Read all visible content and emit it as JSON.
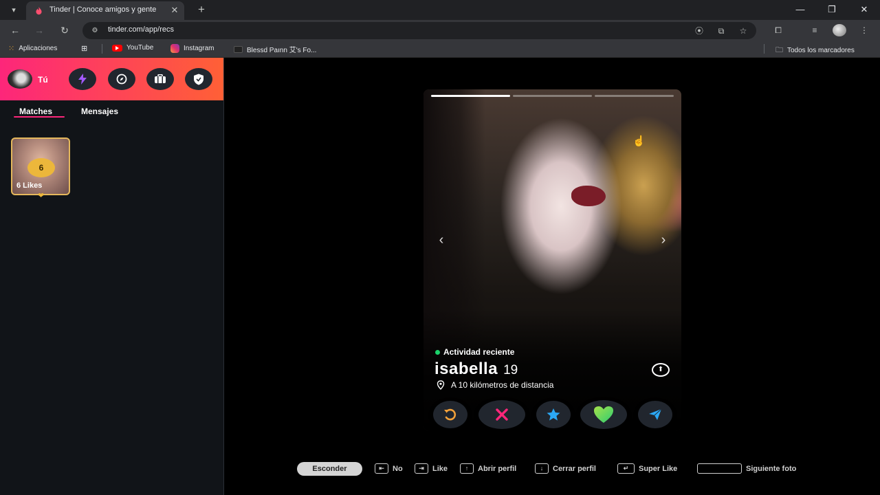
{
  "browser": {
    "tab_title": "Tinder | Conoce amigos y gente",
    "url": "tinder.com/app/recs",
    "bookmarks": {
      "apps": "Aplicaciones",
      "youtube": "YouTube",
      "instagram": "Instagram",
      "blessed": "Blessd Paınn 艾's Fo...",
      "all": "Todos los marcadores"
    }
  },
  "sidebar": {
    "user_label": "Tú",
    "tabs": {
      "matches": "Matches",
      "messages": "Mensajes"
    },
    "likes": {
      "count": "6",
      "label": "6 Likes"
    }
  },
  "profile": {
    "activity": "Actividad reciente",
    "name": "isabella",
    "age": "19",
    "distance": "A 10 kilómetros de distancia",
    "photo_count": 3,
    "active_photo": 1
  },
  "hints": {
    "hide": "Esconder",
    "no": "No",
    "like": "Like",
    "open_profile": "Abrir perfil",
    "close_profile": "Cerrar perfil",
    "super_like": "Super Like",
    "next_photo": "Siguiente foto"
  },
  "colors": {
    "brand_gradient_start": "#fd267a",
    "brand_gradient_end": "#ff6036",
    "rewind": "#f3a13a",
    "nope": "#fd267a",
    "super_like": "#2ba8f5",
    "like": "#5ee37a",
    "boost": "#2ba8f5",
    "likes_gold": "#ecb73b"
  }
}
